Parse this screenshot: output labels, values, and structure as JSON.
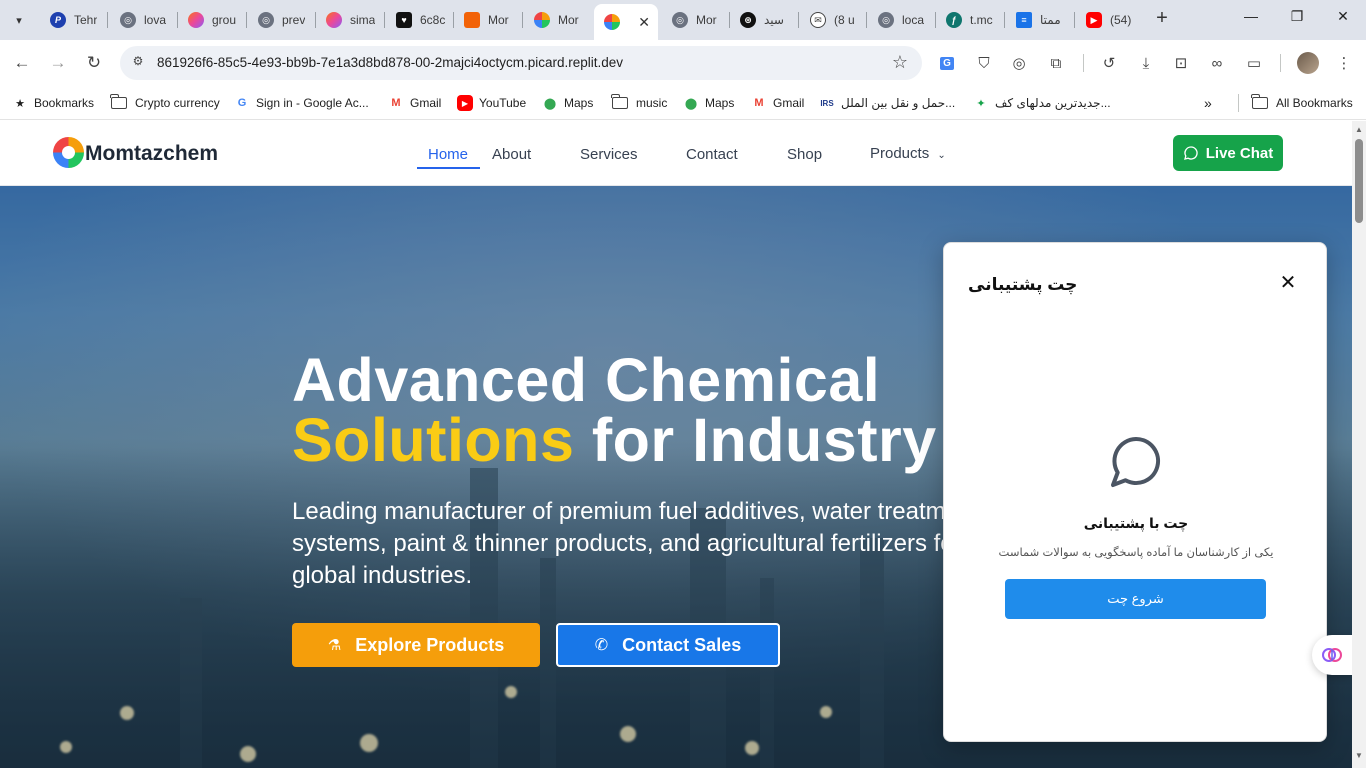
{
  "browser": {
    "tabs": [
      {
        "title": "Tehr",
        "icon": "paypal-icon",
        "color": "#1e40af"
      },
      {
        "title": "lova",
        "icon": "globe-icon",
        "color": "#5f6368"
      },
      {
        "title": "grou",
        "icon": "lovable-icon",
        "color": "#ec4899"
      },
      {
        "title": "prev",
        "icon": "globe-icon",
        "color": "#5f6368"
      },
      {
        "title": "sima",
        "icon": "lovable-icon",
        "color": "#ec4899"
      },
      {
        "title": "6c8c",
        "icon": "heart-icon",
        "color": "#111111"
      },
      {
        "title": "Mor",
        "icon": "replit-icon",
        "color": "#f26207"
      },
      {
        "title": "Mor",
        "icon": "momtazchem-icon",
        "color": "#22c55e"
      },
      {
        "title": "",
        "icon": "momtazchem-icon",
        "color": "#22c55e",
        "active": true
      },
      {
        "title": "Mor",
        "icon": "globe-icon",
        "color": "#5f6368"
      },
      {
        "title": "سید",
        "icon": "openai-icon",
        "color": "#111111"
      },
      {
        "title": "(8 u",
        "icon": "mail-icon",
        "color": "#5f6368"
      },
      {
        "title": "loca",
        "icon": "globe-icon",
        "color": "#5f6368"
      },
      {
        "title": "t.mc",
        "icon": "tool-icon",
        "color": "#0f766e"
      },
      {
        "title": "ممتا",
        "icon": "docs-icon",
        "color": "#1a73e8"
      },
      {
        "title": "(54)",
        "icon": "youtube-icon",
        "color": "#ff0000"
      }
    ],
    "url": "861926f6-85c5-4e93-bb9b-7e1a3d8bd878-00-2majci4octycm.picard.replit.dev",
    "bookmarks": [
      {
        "label": "Bookmarks",
        "icon": "star-icon"
      },
      {
        "label": "Crypto currency",
        "icon": "folder-icon"
      },
      {
        "label": "Sign in - Google Ac...",
        "icon": "google-icon"
      },
      {
        "label": "Gmail",
        "icon": "gmail-icon"
      },
      {
        "label": "YouTube",
        "icon": "youtube-icon"
      },
      {
        "label": "Maps",
        "icon": "maps-icon"
      },
      {
        "label": "music",
        "icon": "folder-icon"
      },
      {
        "label": "Maps",
        "icon": "maps-icon"
      },
      {
        "label": "Gmail",
        "icon": "gmail-icon"
      },
      {
        "label": "حمل و نقل بین الملل...",
        "icon": "shipping-icon"
      },
      {
        "label": "جدیدترین مدلهای کف...",
        "icon": "sparkle-icon"
      }
    ],
    "all_bookmarks": "All Bookmarks"
  },
  "site": {
    "brand": "Momtazchem",
    "nav": {
      "home": "Home",
      "about": "About",
      "services": "Services",
      "contact": "Contact",
      "shop": "Shop",
      "products": "Products"
    },
    "live_chat": "Live Chat",
    "hero": {
      "title_line1": "Advanced Chemical",
      "title_highlight": "Solutions",
      "title_rest": " for Industry",
      "subtitle": "Leading manufacturer of premium fuel additives, water treatment systems, paint & thinner products, and agricultural fertilizers for global industries.",
      "btn_explore": "Explore Products",
      "btn_contact": "Contact Sales"
    },
    "chat": {
      "title": "چت پشتیبانی",
      "heading": "چت با پشتیبانی",
      "description": "یکی از کارشناسان ما آماده پاسخگویی به سوالات شماست",
      "start": "شروع چت"
    }
  },
  "colors": {
    "accent": "#2563eb",
    "live_chat": "#16a34a",
    "explore": "#f59e0b",
    "contact": "#1877e8",
    "highlight": "#facc15"
  }
}
